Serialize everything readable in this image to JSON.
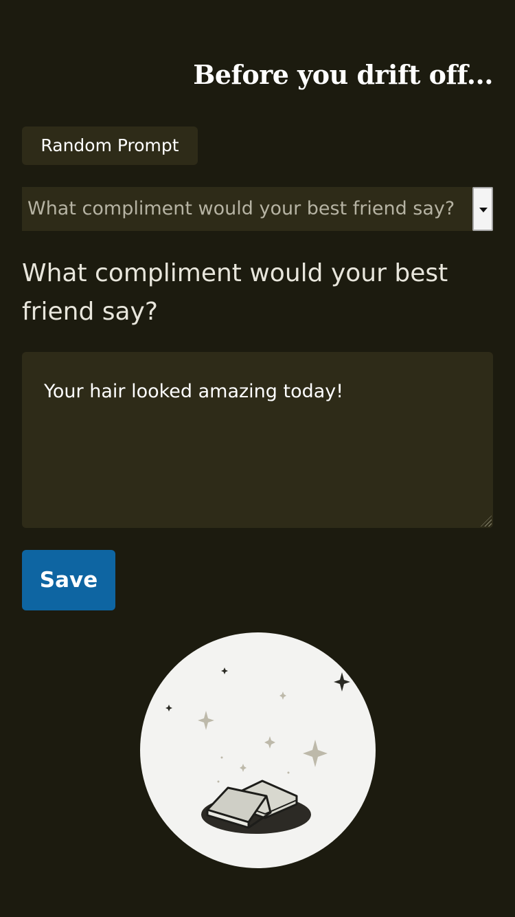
{
  "header": {
    "title": "Before you drift off..."
  },
  "controls": {
    "random_prompt_label": "Random Prompt",
    "selected_prompt": "What compliment would your best friend say?",
    "save_label": "Save"
  },
  "prompt": {
    "question": "What compliment would your best friend say?"
  },
  "entry": {
    "text": "Your hair looked amazing today!"
  },
  "illustration": {
    "subject": "open books with sparkles",
    "icon": "books-sparkles-icon"
  },
  "colors": {
    "background": "#1c1b0f",
    "panel": "#2e2b18",
    "accent": "#0e65a2",
    "title_text": "#ffffff",
    "body_text": "#e8e6dc",
    "muted_text": "#b6b3a3",
    "illustration_bg": "#f3f3f1"
  }
}
